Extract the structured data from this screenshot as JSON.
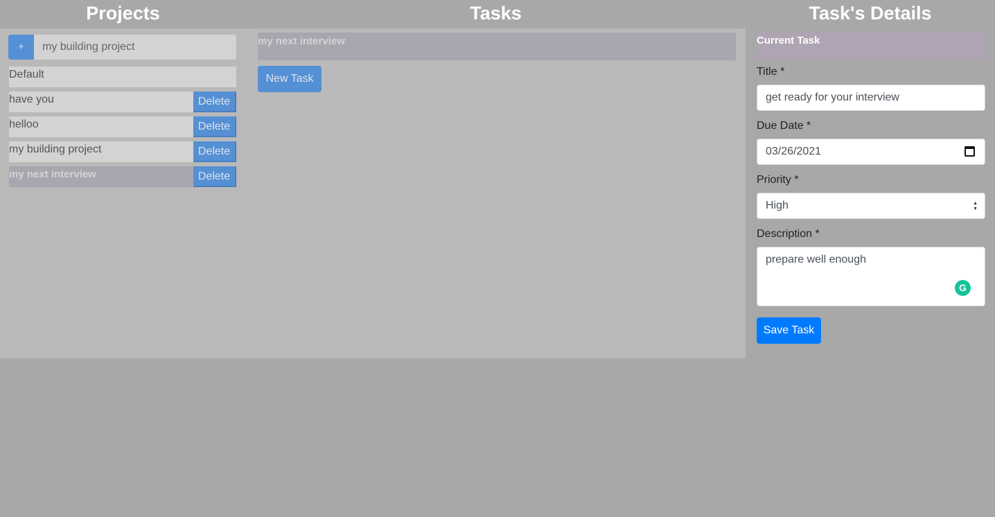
{
  "headers": {
    "projects": "Projects",
    "tasks": "Tasks",
    "details": "Task's Details"
  },
  "projects": {
    "add_label": "+",
    "input_value": "my building project",
    "items": [
      {
        "name": "Default"
      },
      {
        "name": "have you",
        "delete": "Delete"
      },
      {
        "name": "helloo",
        "delete": "Delete"
      },
      {
        "name": "my building project",
        "delete": "Delete"
      },
      {
        "name": "my next interview",
        "delete": "Delete",
        "selected": true
      }
    ]
  },
  "tasks": {
    "items": [
      {
        "name": "my next interview"
      }
    ],
    "new_task": "New Task"
  },
  "details": {
    "heading": "Current Task",
    "title_label": "Title *",
    "title_value": "get ready for your interview",
    "due_label": "Due Date *",
    "due_value": "03/26/2021",
    "priority_label": "Priority *",
    "priority_value": "High",
    "description_label": "Description *",
    "description_value": "prepare well enough",
    "grammarly": "G",
    "save": "Save Task"
  },
  "colors": {
    "accent": "#5590d4",
    "save": "#007bff",
    "selected": "#aaa6b0"
  }
}
